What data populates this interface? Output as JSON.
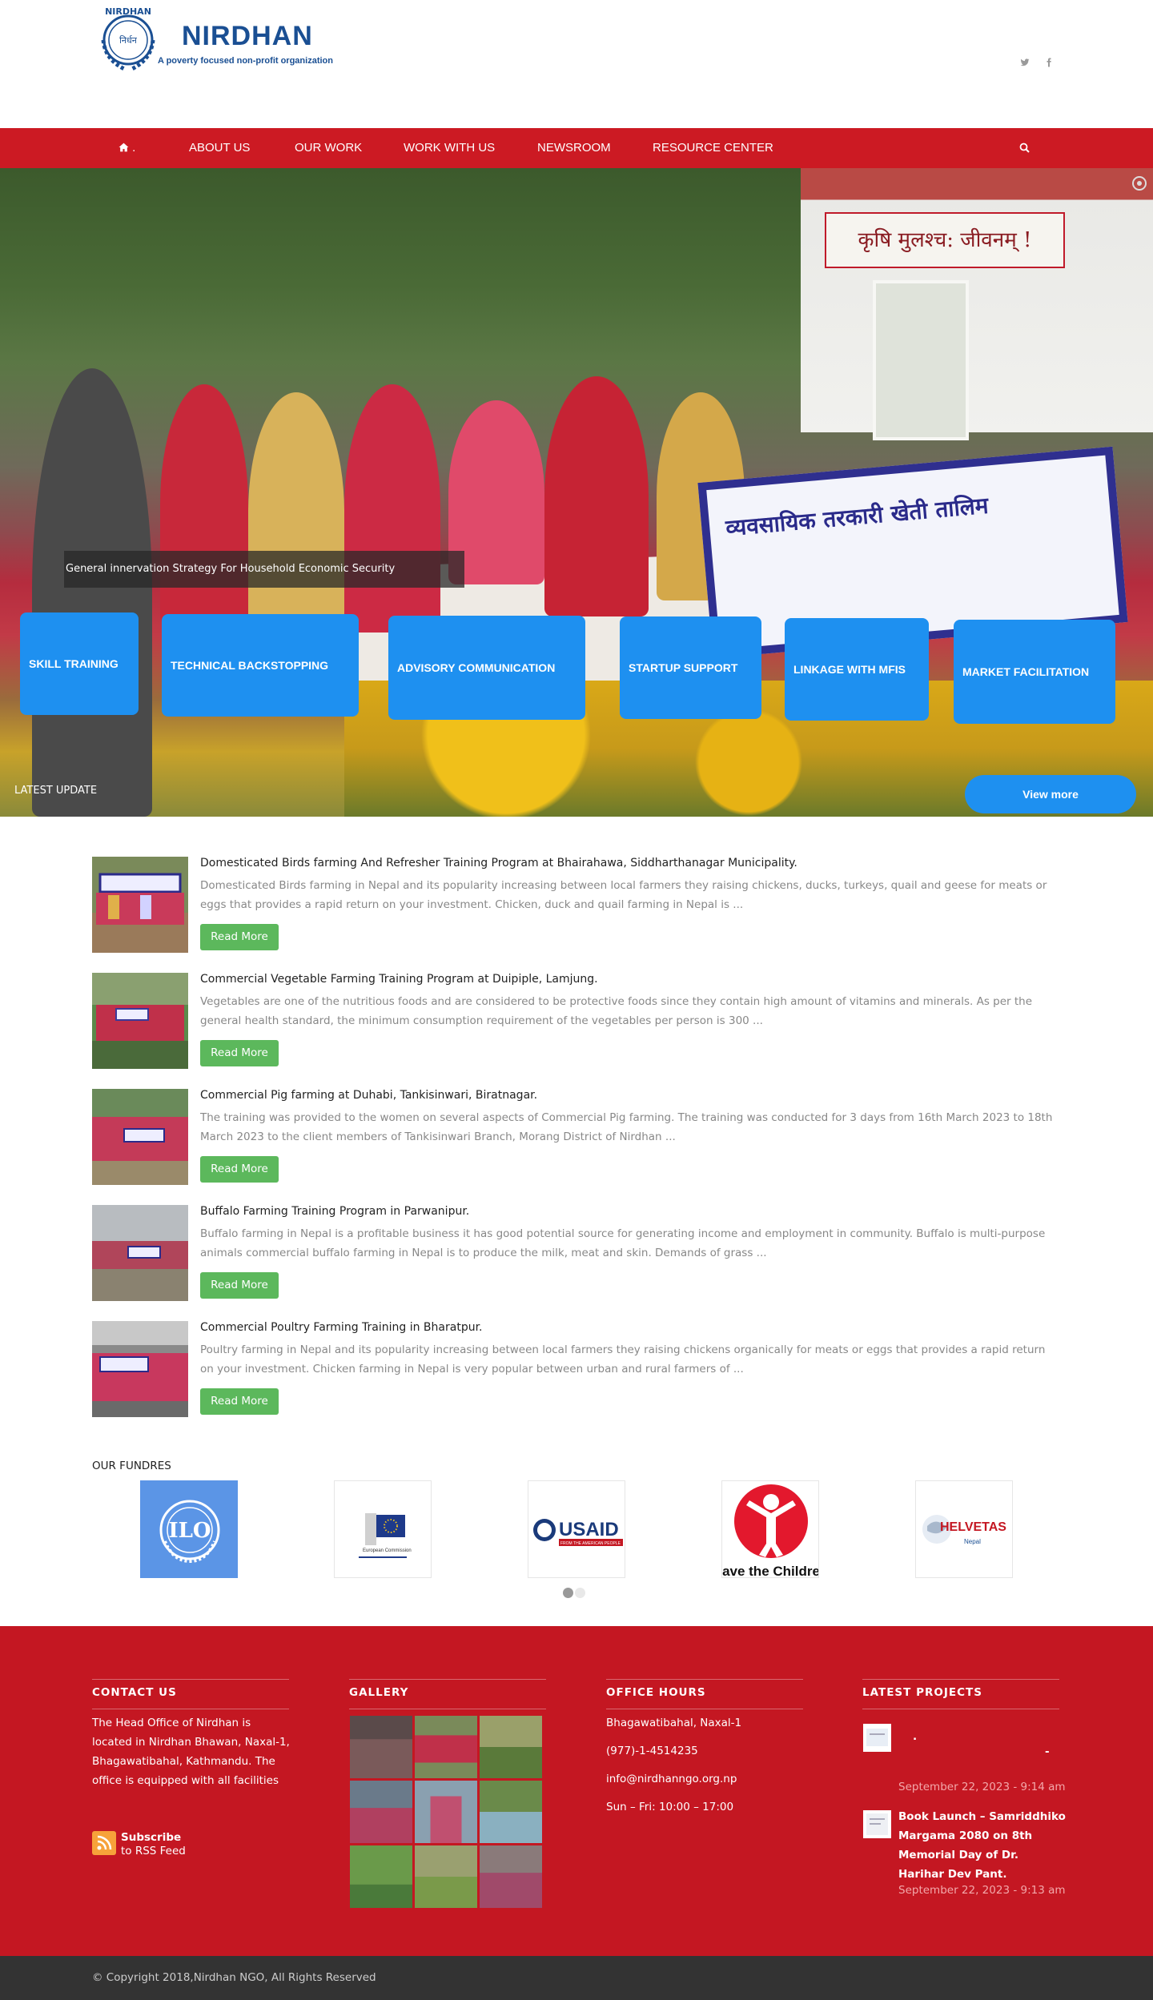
{
  "header": {
    "logo_emblem_text": "NIRDHAN",
    "logo_title": "NIRDHAN",
    "logo_tagline": "A poverty focused non-profit organization",
    "social": [
      {
        "icon": "twitter-icon"
      },
      {
        "icon": "facebook-icon"
      }
    ]
  },
  "nav": {
    "home_label": ".",
    "items": [
      {
        "label": "ABOUT US"
      },
      {
        "label": "OUR WORK"
      },
      {
        "label": "WORK WITH US"
      },
      {
        "label": "NEWSROOM"
      },
      {
        "label": "RESOURCE CENTER"
      }
    ]
  },
  "hero": {
    "caption": "General innervation Strategy For Household Economic Security",
    "sign_text": "कृषि मुलश्च: जीवनम् !",
    "banner_text": "व्यवसायिक तरकारी खेती तालिम",
    "services": [
      {
        "label": "SKILL TRAINING"
      },
      {
        "label": "TECHNICAL BACKSTOPPING"
      },
      {
        "label": "ADVISORY COMMUNICATION"
      },
      {
        "label": "STARTUP SUPPORT"
      },
      {
        "label": "LINKAGE WITH MFIS"
      },
      {
        "label": "MARKET FACILITATION"
      }
    ],
    "latest_update_label": "LATEST UPDATE",
    "view_more_label": "View more"
  },
  "news": [
    {
      "title": "Domesticated Birds farming And Refresher Training Program at Bhairahawa, Siddharthanagar Municipality.",
      "excerpt": "Domesticated Birds farming in Nepal and its popularity increasing between local farmers they raising chickens, ducks, turkeys, quail and geese for meats or eggs that provides a rapid return on your investment. Chicken, duck and quail farming in Nepal is ...",
      "read_more": "Read More"
    },
    {
      "title": "Commercial Vegetable Farming Training Program at Duipiple, Lamjung.",
      "excerpt": "Vegetables are one of the nutritious foods and are considered to be protective foods since they contain high amount of vitamins and minerals. As per the general health standard, the minimum consumption requirement of the vegetables per person is 300 ...",
      "read_more": "Read More"
    },
    {
      "title": "Commercial Pig farming at Duhabi, Tankisinwari, Biratnagar.",
      "excerpt": "The training was provided to the women on several aspects of Commercial Pig farming. The training was conducted for 3 days from 16th March 2023 to 18th March 2023 to the client members of Tankisinwari Branch, Morang District of Nirdhan ...",
      "read_more": "Read More"
    },
    {
      "title": "Buffalo Farming Training Program in Parwanipur.",
      "excerpt": "Buffalo farming in Nepal is a profitable business it has good potential source for generating income and employment in community. Buffalo is multi-purpose animals commercial buffalo farming in Nepal is to produce the milk, meat and skin. Demands of grass ...",
      "read_more": "Read More"
    },
    {
      "title": "Commercial Poultry Farming Training in Bharatpur.",
      "excerpt": "Poultry farming in Nepal and its popularity increasing between local farmers they raising chickens organically for meats or eggs that provides a rapid return on your investment. Chicken farming in Nepal is very popular between urban and rural farmers of ...",
      "read_more": "Read More"
    }
  ],
  "funders": {
    "title": "OUR FUNDRES",
    "logos": [
      {
        "name": "ILO",
        "text": "ILO"
      },
      {
        "name": "European Commission",
        "text": "European Commission"
      },
      {
        "name": "USAID",
        "text": "USAID",
        "sub": "FROM THE AMERICAN PEOPLE"
      },
      {
        "name": "Save the Children",
        "text": "ave the Childre"
      },
      {
        "name": "HELVETAS",
        "text": "HELVETAS",
        "sub": "Nepal"
      }
    ],
    "active_dot": 0
  },
  "footer": {
    "contact": {
      "title": "CONTACT US",
      "text": "The Head Office of Nirdhan is located in Nirdhan Bhawan, Naxal-1, Bhagawatibahal, Kathmandu. The office is equipped with all facilities",
      "subscribe_title": "Subscribe",
      "subscribe_sub": "to RSS Feed"
    },
    "gallery": {
      "title": "GALLERY"
    },
    "hours": {
      "title": "OFFICE HOURS",
      "lines": [
        "Bhagawatibahal, Naxal-1",
        "(977)-1-4514235",
        "info@nirdhanngo.org.np",
        "Sun – Fri: 10:00 – 17:00"
      ]
    },
    "projects": {
      "title": "LATEST PROJECTS",
      "items": [
        {
          "title": ".",
          "title_suffix": "-",
          "date": "September 22, 2023 - 9:14 am"
        },
        {
          "title": "Book Launch – Samriddhiko Margama 2080 on 8th Memorial Day of Dr. Harihar Dev Pant.",
          "date": "September 22, 2023 - 9:13 am"
        }
      ]
    }
  },
  "copyright": "© Copyright 2018,Nirdhan NGO, All Rights Reserved",
  "colors": {
    "brand_red": "#cc1a23",
    "footer_red": "#c41722",
    "service_blue": "#1e90f0",
    "read_more_green": "#5cb85c",
    "logo_blue": "#1a4f93"
  }
}
